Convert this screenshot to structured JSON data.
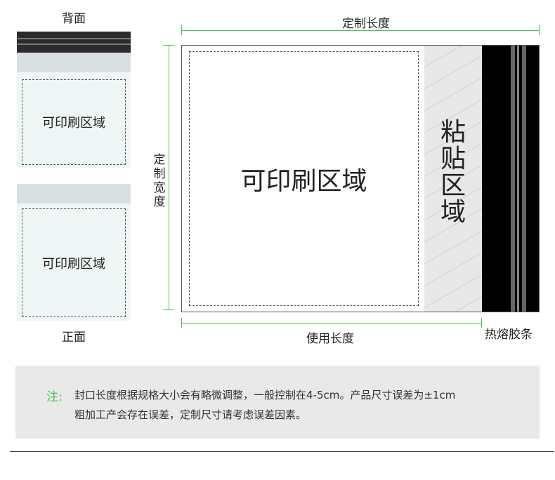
{
  "back": {
    "title": "背面",
    "print_label": "可印刷区域"
  },
  "front": {
    "title": "正面",
    "print_label": "可印刷区域"
  },
  "diagram": {
    "custom_length_label": "定制长度",
    "custom_width_label": [
      "定",
      "制",
      "宽",
      "度"
    ],
    "usable_length_label": "使用长度",
    "heat_strip_label": "热熔胶条",
    "print_area_label": "可印刷区域",
    "adhesive_area_label": [
      "粘",
      "贴",
      "区",
      "域"
    ]
  },
  "note": {
    "prefix": "注:",
    "line1": "封口长度根据规格大小会有略微调整，一般控制在4-5cm。产品尺寸误差为±1cm",
    "line2": "粗加工产会存在误差，定制尺寸请考虑误差因素。"
  },
  "colors": {
    "dimension_line": "#4bc25a",
    "heat_strip": "#000000",
    "panel_background": "#eef6f6",
    "note_background": "#e9e9e9"
  }
}
